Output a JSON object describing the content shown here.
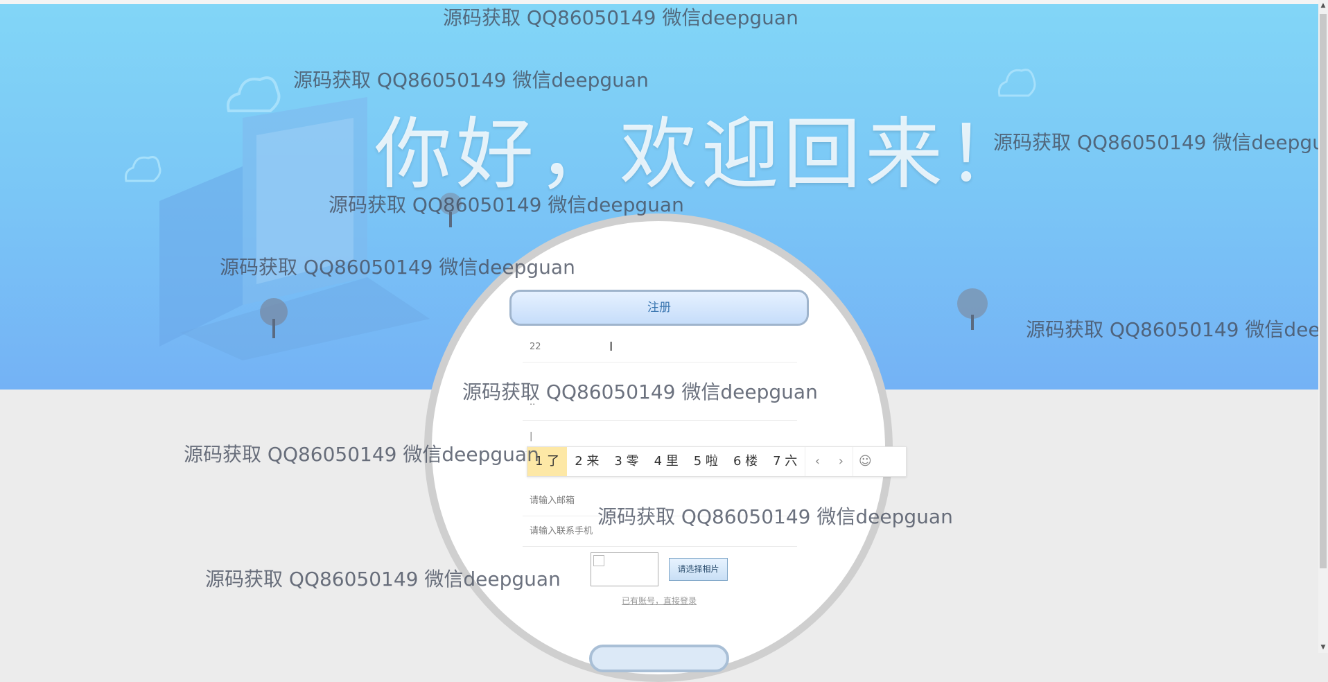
{
  "hero": {
    "title": "你好，欢迎回来！"
  },
  "form": {
    "register_button": "注册",
    "username_value": "22",
    "password_value": "··",
    "confirm_value": "|",
    "email_placeholder": "请输入邮箱",
    "phone_placeholder": "请输入联系手机",
    "photo_button": "请选择相片",
    "login_link": "已有账号，直接登录"
  },
  "ime": {
    "candidates": [
      "1 了",
      "2 来",
      "3 零",
      "4 里",
      "5 啦",
      "6 楼",
      "7 六"
    ],
    "prev": "‹",
    "next": "›",
    "emoji": "☺"
  },
  "watermark": "源码获取 QQ86050149 微信deepguan",
  "colors": {
    "hero_top": "#82d6f7",
    "hero_bottom": "#74b2f5",
    "ime_selected": "#fde8a6"
  }
}
